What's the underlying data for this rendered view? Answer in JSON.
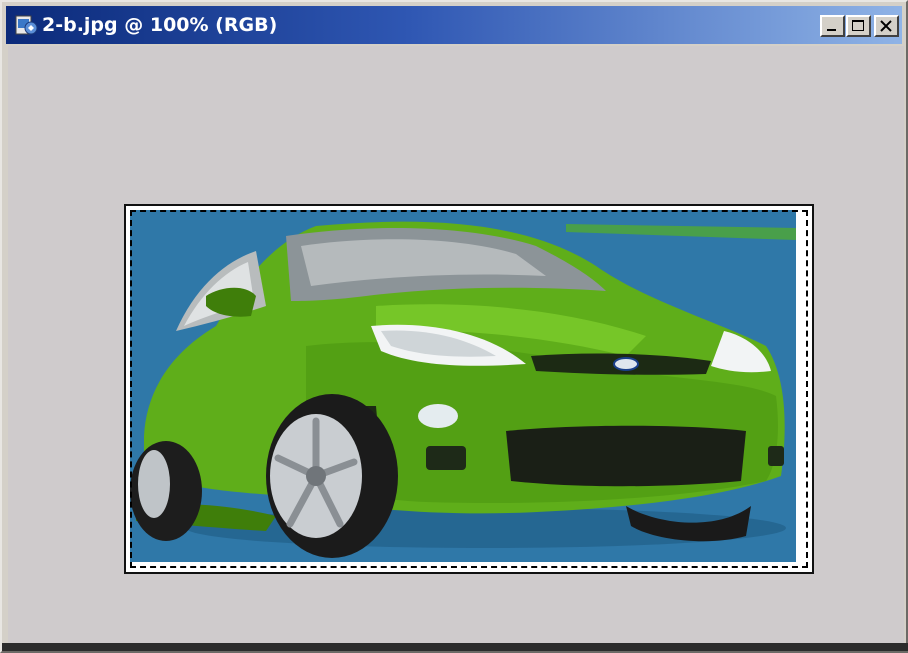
{
  "window": {
    "title": "2-b.jpg @ 100% (RGB)"
  },
  "canvas": {
    "document_name": "2-b.jpg",
    "zoom": "100%",
    "color_mode": "RGB",
    "selection": "marquee"
  },
  "icons": {
    "app": "photoshop-document-icon",
    "minimize": "minimize-icon",
    "maximize": "maximize-icon",
    "close": "close-icon"
  },
  "colors": {
    "canvas_bg": "#cfcbcc",
    "image_bg": "#2f78a8",
    "car_body": "#5fae1a",
    "titlebar_start": "#0b2a7a",
    "titlebar_end": "#8fb3e6"
  }
}
